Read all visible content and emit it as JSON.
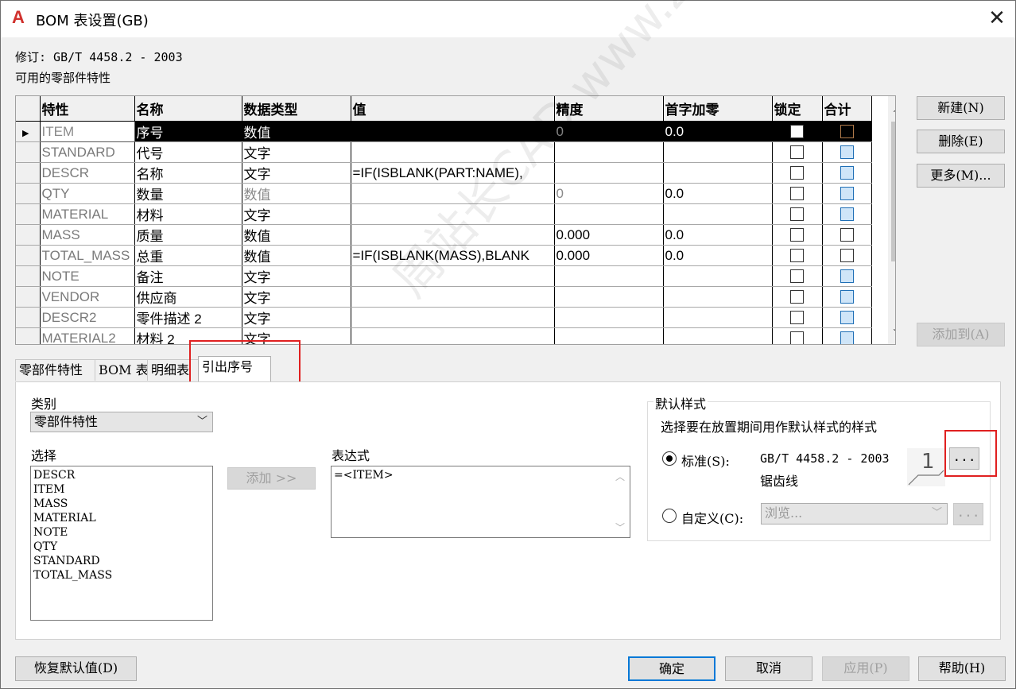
{
  "window": {
    "title": "BOM 表设置(GB)",
    "close_glyph": "✕",
    "app_glyph": "A"
  },
  "revision": "修订: GB/T 4458.2 - 2003",
  "available_label": "可用的零部件特性",
  "grid": {
    "columns": [
      "特性",
      "名称",
      "数据类型",
      "值",
      "精度",
      "首字加零",
      "锁定",
      "合计"
    ],
    "rows": [
      {
        "prop": "ITEM",
        "name": "序号",
        "type": "数值",
        "value": "",
        "precision": "0",
        "zero": "0.0",
        "lock": false,
        "sum": "brown",
        "selected": true,
        "type_gray": false,
        "prec_gray": true
      },
      {
        "prop": "STANDARD",
        "name": "代号",
        "type": "文字",
        "value": "",
        "precision": "",
        "zero": "",
        "lock": false,
        "sum": "blue"
      },
      {
        "prop": "DESCR",
        "name": "名称",
        "type": "文字",
        "value": "=IF(ISBLANK(PART:NAME),",
        "precision": "",
        "zero": "",
        "lock": false,
        "sum": "blue"
      },
      {
        "prop": "QTY",
        "name": "数量",
        "type": "数值",
        "value": "",
        "precision": "0",
        "zero": "0.0",
        "lock": false,
        "sum": "blue",
        "type_gray": true,
        "prec_gray": true
      },
      {
        "prop": "MATERIAL",
        "name": "材料",
        "type": "文字",
        "value": "",
        "precision": "",
        "zero": "",
        "lock": false,
        "sum": "blue"
      },
      {
        "prop": "MASS",
        "name": "质量",
        "type": "数值",
        "value": "",
        "precision": "0.000",
        "zero": "0.0",
        "lock": false,
        "sum": "white"
      },
      {
        "prop": "TOTAL_MASS",
        "name": "总重",
        "type": "数值",
        "value": "=IF(ISBLANK(MASS),BLANK",
        "precision": "0.000",
        "zero": "0.0",
        "lock": false,
        "sum": "white"
      },
      {
        "prop": "NOTE",
        "name": "备注",
        "type": "文字",
        "value": "",
        "precision": "",
        "zero": "",
        "lock": false,
        "sum": "blue"
      },
      {
        "prop": "VENDOR",
        "name": "供应商",
        "type": "文字",
        "value": "",
        "precision": "",
        "zero": "",
        "lock": false,
        "sum": "blue"
      },
      {
        "prop": "DESCR2",
        "name": "零件描述 2",
        "type": "文字",
        "value": "",
        "precision": "",
        "zero": "",
        "lock": false,
        "sum": "blue"
      },
      {
        "prop": "MATERIAL2",
        "name": "材料 2",
        "type": "文字",
        "value": "",
        "precision": "",
        "zero": "",
        "lock": false,
        "sum": "blue"
      }
    ]
  },
  "side_buttons": {
    "new": "新建(N)",
    "delete": "删除(E)",
    "more": "更多(M)...",
    "add_to": "添加到(A)"
  },
  "tabs": [
    "零部件特性",
    "BOM 表",
    "明细表",
    "引出序号"
  ],
  "panel": {
    "category_label": "类别",
    "category_value": "零部件特性",
    "select_label": "选择",
    "select_items": [
      "DESCR",
      "ITEM",
      "MASS",
      "MATERIAL",
      "NOTE",
      "QTY",
      "STANDARD",
      "TOTAL_MASS"
    ],
    "add_button": "添加 >>",
    "expression_label": "表达式",
    "expression_value": "=<ITEM>",
    "default_style_label": "默认样式",
    "default_style_desc": "选择要在放置期间用作默认样式的样式",
    "standard_radio": "标准(S):",
    "standard_value_line1": "GB/T 4458.2 - 2003",
    "standard_value_line2": "锯齿线",
    "preview_number": "1",
    "browse_dots": "...",
    "custom_radio": "自定义(C):",
    "custom_value": "浏览...",
    "custom_dots": "..."
  },
  "footer": {
    "restore": "恢复默认值(D)",
    "ok": "确定",
    "cancel": "取消",
    "apply": "应用(P)",
    "help": "帮助(H)"
  },
  "watermark": "周站长CAD  www.zzzcad.com",
  "colors": {
    "accent": "#0078d7",
    "highlight_box": "#e02020",
    "checkbox_blue": "#cfe5f8"
  }
}
